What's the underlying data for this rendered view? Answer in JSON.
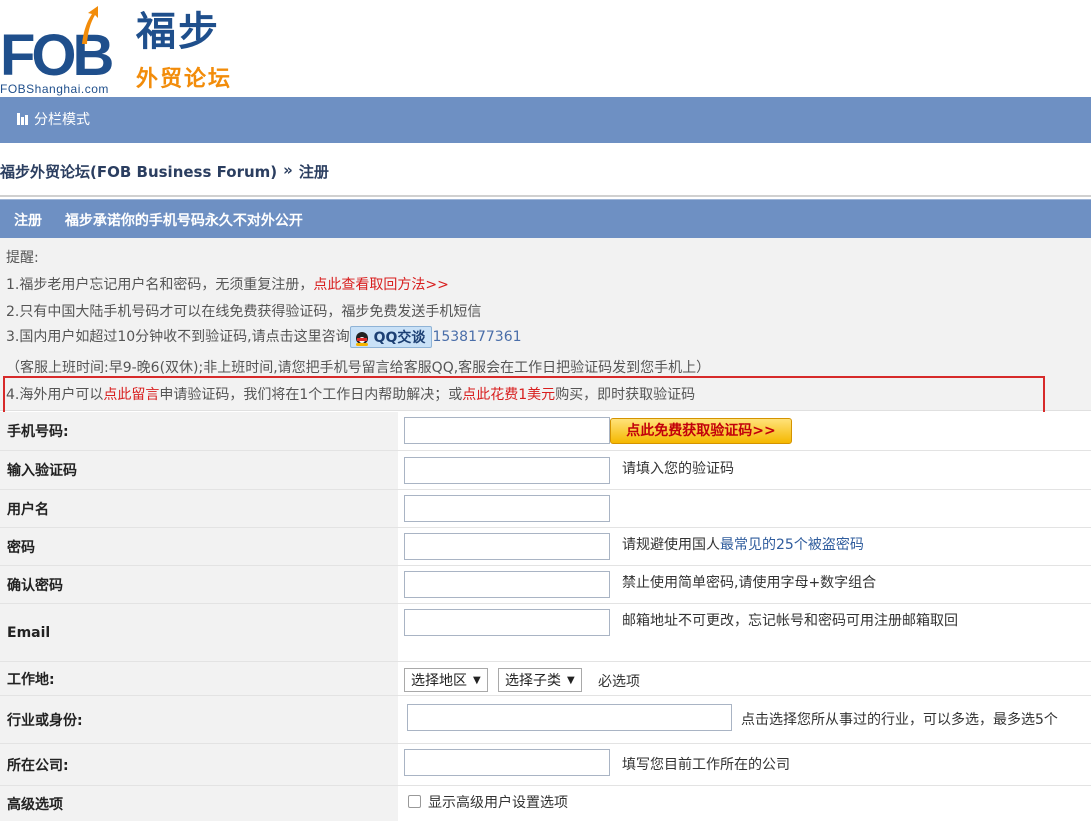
{
  "logo": {
    "brand": "FOB",
    "site": "FOBShanghai.com",
    "name_cn": "福步",
    "sub_cn": "外贸论坛"
  },
  "nav": {
    "mode_label": "分栏模式"
  },
  "breadcrumb": {
    "forum": "福步外贸论坛(FOB Business Forum)",
    "separator": "»",
    "current": "注册"
  },
  "reg_header": {
    "title": "注册",
    "promise": "福步承诺你的手机号码永久不对外公开"
  },
  "notice": {
    "label": "提醒:",
    "line1_text": "1.福步老用户忘记用户名和密码，无须重复注册，",
    "line1_link": "点此查看取回方法>>",
    "line2": "2.只有中国大陆手机号码才可以在线免费获得验证码，福步免费发送手机短信",
    "line3_text": "3.国内用户如超过10分钟收不到验证码,请点击这里咨询",
    "qq_label": "QQ交谈",
    "qq_number": "1538177361",
    "line4": "（客服上班时间:早9-晚6(双休);非上班时间,请您把手机号留言给客服QQ,客服会在工作日把验证码发到您手机上）",
    "line5_a": "4.海外用户可以",
    "line5_link1": "点此留言",
    "line5_b": "申请验证码，我们将在1个工作日内帮助解决；或",
    "line5_link2": "点此花费1美元",
    "line5_c": "购买，即时获取验证码"
  },
  "form": {
    "phone_label": "手机号码:",
    "get_code_button": "点此免费获取验证码>>",
    "code_label": "输入验证码",
    "code_hint": "请填入您的验证码",
    "username_label": "用户名",
    "password_label": "密码",
    "password_hint_a": "请规避使用国人",
    "password_hint_link": "最常见的25个被盗密码",
    "confirm_label": "确认密码",
    "confirm_hint": "禁止使用简单密码,请使用字母+数字组合",
    "email_label": "Email",
    "email_hint": "邮箱地址不可更改，忘记帐号和密码可用注册邮箱取回",
    "work_label": "工作地:",
    "region_select": "选择地区",
    "subtype_select": "选择子类",
    "required_hint": "必选项",
    "industry_label": "行业或身份:",
    "industry_hint": "点击选择您所从事过的行业，可以多选，最多选5个",
    "company_label": "所在公司:",
    "company_hint": "填写您目前工作所在的公司",
    "advanced_label": "高级选项",
    "advanced_checkbox": "显示高级用户设置选项"
  },
  "colors": {
    "bar_blue": "#6e90c3",
    "link_red": "#d81e1e",
    "highlight_red": "#d72a2a",
    "button_yellow": "#f5b800"
  }
}
